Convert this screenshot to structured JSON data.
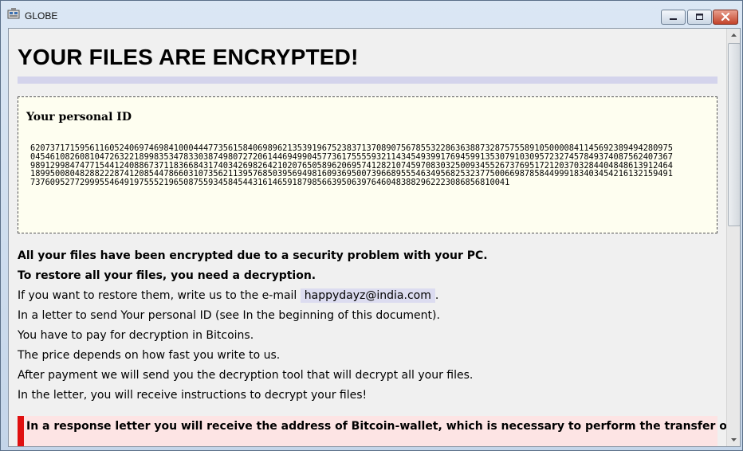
{
  "window": {
    "title": "GLOBE",
    "icons": {
      "app": "app-icon",
      "minimize": "minimize-icon",
      "maximize": "maximize-icon",
      "close": "close-icon"
    }
  },
  "note": {
    "heading": "YOUR FILES ARE ENCRYPTED!",
    "personal_id_label": "Your personal ID",
    "personal_id": "62073717159561160524069746984100044477356158406989621353919675238371370890756785532286363887328757558910500008411456923894942809750454610826081047263221899835347833038749807272061446949904577361755559321143454939917694599135307910309572327457849374087562407367989129984747715441240886737118366843174034269826421020765058962069574128210745970830325009345526737695172120370328440484861391246418995008048288222874120854478660310735621139576850395694981609369500739668955546349568253237750066987858449991834034542161321594917376095277299955464919755521965087559345845443161465918798566395063976460483882962223086856810041",
    "lines": [
      {
        "text": "All your files have been encrypted due to a security problem with your PC.",
        "bold": true
      },
      {
        "text": "To restore all your files, you need a decryption.",
        "bold": true
      },
      {
        "prefix": "If you want to restore them, write us to the e-mail",
        "email": "happydayz@india.com",
        "suffix": "."
      },
      {
        "text": "In a letter to send Your personal ID (see In the beginning of this document)."
      },
      {
        "text": "You have to pay for decryption in Bitcoins."
      },
      {
        "text": "The price depends on how fast you write to us."
      },
      {
        "text": "After payment we will send you the decryption tool that will decrypt all your files."
      },
      {
        "text": "In the letter, you will receive instructions to decrypt your files!"
      }
    ],
    "alert": "In a response letter you will receive the address of Bitcoin-wallet, which is necessary to perform the transfer of funds."
  },
  "colors": {
    "heading_rule": "#d4d4ec",
    "id_box_bg": "#fefef0",
    "email_highlight": "#dcdcf0",
    "alert_bg": "#fde4e4",
    "alert_bar": "#e01010"
  }
}
